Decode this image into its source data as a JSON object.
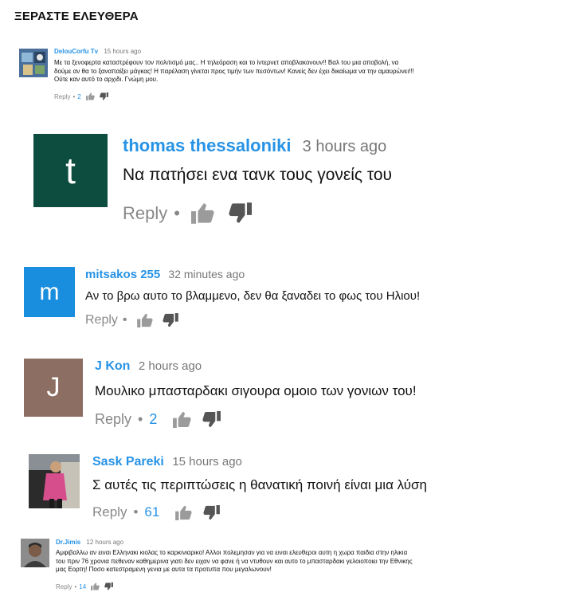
{
  "title": "ΞΕΡΑΣΤΕ ΕΛΕΥΘΕΡΑ",
  "comments": [
    {
      "author": "DelouCorfu Tv",
      "time": "15 hours ago",
      "lines": [
        "Με τα ξενοφερτα καταστρέφουν τον πολιτισμό μας.. Η τηλεόραση και το ίντερνετ αποβλακονουν!! Βαλ του μια αποβολή, να",
        "δούμε αν θα το ξαναπαίξει μάγκας! Η παρέλαση γίνεται προς τιμήν των πεσόντων! Κανείς δεν έχει δικαίωμα να την αμαυρώνει!!!",
        "Ούτε καν αυτό το αρχιδι. Γνώμη μου."
      ],
      "reply": "Reply",
      "likes": "2",
      "icons": [
        "thumbs-up-icon",
        "thumbs-down-icon"
      ]
    },
    {
      "author": "thomas thessaloniki",
      "time": "3 hours ago",
      "lines": [
        "Να πατήσει ενα τανκ τους γονείς του"
      ],
      "reply": "Reply",
      "likes": "",
      "avatar_letter": "t",
      "avatar_color": "#0d4d3f"
    },
    {
      "author": "mitsakos 255",
      "time": "32 minutes ago",
      "lines": [
        "Αν το βρω αυτο το βλαμμενο, δεν θα ξαναδει το φως του Ηλιου!"
      ],
      "reply": "Reply",
      "likes": "",
      "avatar_letter": "m",
      "avatar_color": "#1a8ede"
    },
    {
      "author": "J Kon",
      "time": "2 hours ago",
      "lines": [
        "Μουλικο μπασταρδακι σιγουρα ομοιο των γονιων του!"
      ],
      "reply": "Reply",
      "likes": "2",
      "avatar_letter": "J",
      "avatar_color": "#8d6e63"
    },
    {
      "author": "Sask Pareki",
      "time": "15 hours ago",
      "lines": [
        "Σ αυτές τις περιπτώσεις η θανατική ποινή είναι μια λύση"
      ],
      "reply": "Reply",
      "likes": "61"
    },
    {
      "author": "Dr.Jimis",
      "time": "12 hours ago",
      "lines": [
        "Αμφιβαλλω αν ειναι Ελληνακι κιολας το καρκινιαρικο! Αλλοι πολεμησαν για να ειναι ελευθεροι αυτη η χωρα παιδια στην ηλικια",
        "του πριν 76 χρονια πεθεναν καθημερινα γιατι δεν ειχαν να φανε ή να ντυθουν και αυτο το μπασταρδακι γελοιοποιει την Εθνικης",
        "μας Εορτη! Ποσο κατεστραμενη γενια με αυτα τα προτυπα που μεγαλωνουν!"
      ],
      "reply": "Reply",
      "likes": "14"
    }
  ]
}
